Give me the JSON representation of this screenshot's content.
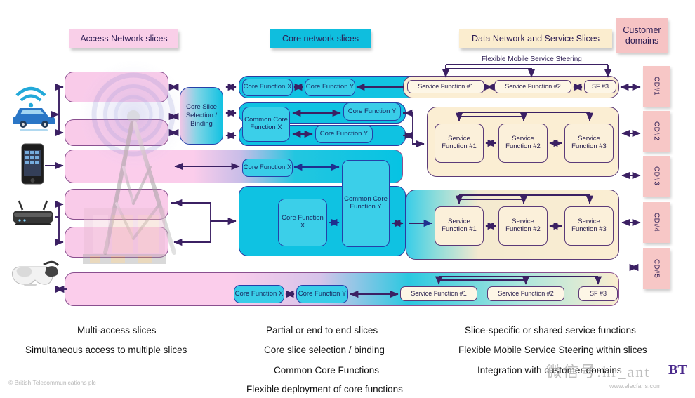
{
  "headers": {
    "access": "Access Network slices",
    "core": "Core network slices",
    "data": "Data Network and Service Slices",
    "customer": "Customer domains"
  },
  "annotations": {
    "steering": "Flexible Mobile Service Steering"
  },
  "core_slice_selection": {
    "label": "Core Slice Selection / Binding"
  },
  "devices": [
    {
      "name": "connected-car-icon",
      "label": "Connected car"
    },
    {
      "name": "smartphone-icon",
      "label": "Smartphone"
    },
    {
      "name": "router-icon",
      "label": "Home router"
    },
    {
      "name": "vr-headset-icon",
      "label": "VR headset"
    }
  ],
  "core_functions": {
    "x": "Core Function X",
    "y": "Core Function Y",
    "common_x": "Common Core Function X",
    "common_y": "Common Core Function Y"
  },
  "service_functions": {
    "sf1_short": "Service Function #1",
    "sf2_short": "Service Function #2",
    "sf3_short": "SF #3",
    "sf1": "Service Function #1",
    "sf2": "Service Function #2",
    "sf3": "Service Function #3"
  },
  "customer_domains": [
    {
      "label": "CD#1"
    },
    {
      "label": "CD#2"
    },
    {
      "label": "CD#3"
    },
    {
      "label": "CD#4"
    },
    {
      "label": "CD#5"
    }
  ],
  "captions": {
    "access": [
      "Multi-access slices",
      "Simultaneous access to multiple slices"
    ],
    "core": [
      "Partial or end to end slices",
      "Core slice selection / binding",
      "Common Core Functions",
      "Flexible deployment of core functions"
    ],
    "data": [
      "Slice-specific or shared service functions",
      "Flexible Mobile Service Steering within slices",
      "Integration with customer domains"
    ]
  },
  "footer": {
    "copyright": "© British Telecommunications plc",
    "watermark": "微信号:hr_ant",
    "watermark_sub": "www.elecfans.com",
    "brand": "BT"
  },
  "colors": {
    "pink": "#f9cbe9",
    "cyan": "#0fc2e2",
    "cream": "#fbeed3",
    "salmon": "#f7c7c6",
    "purple": "#3b2063"
  }
}
